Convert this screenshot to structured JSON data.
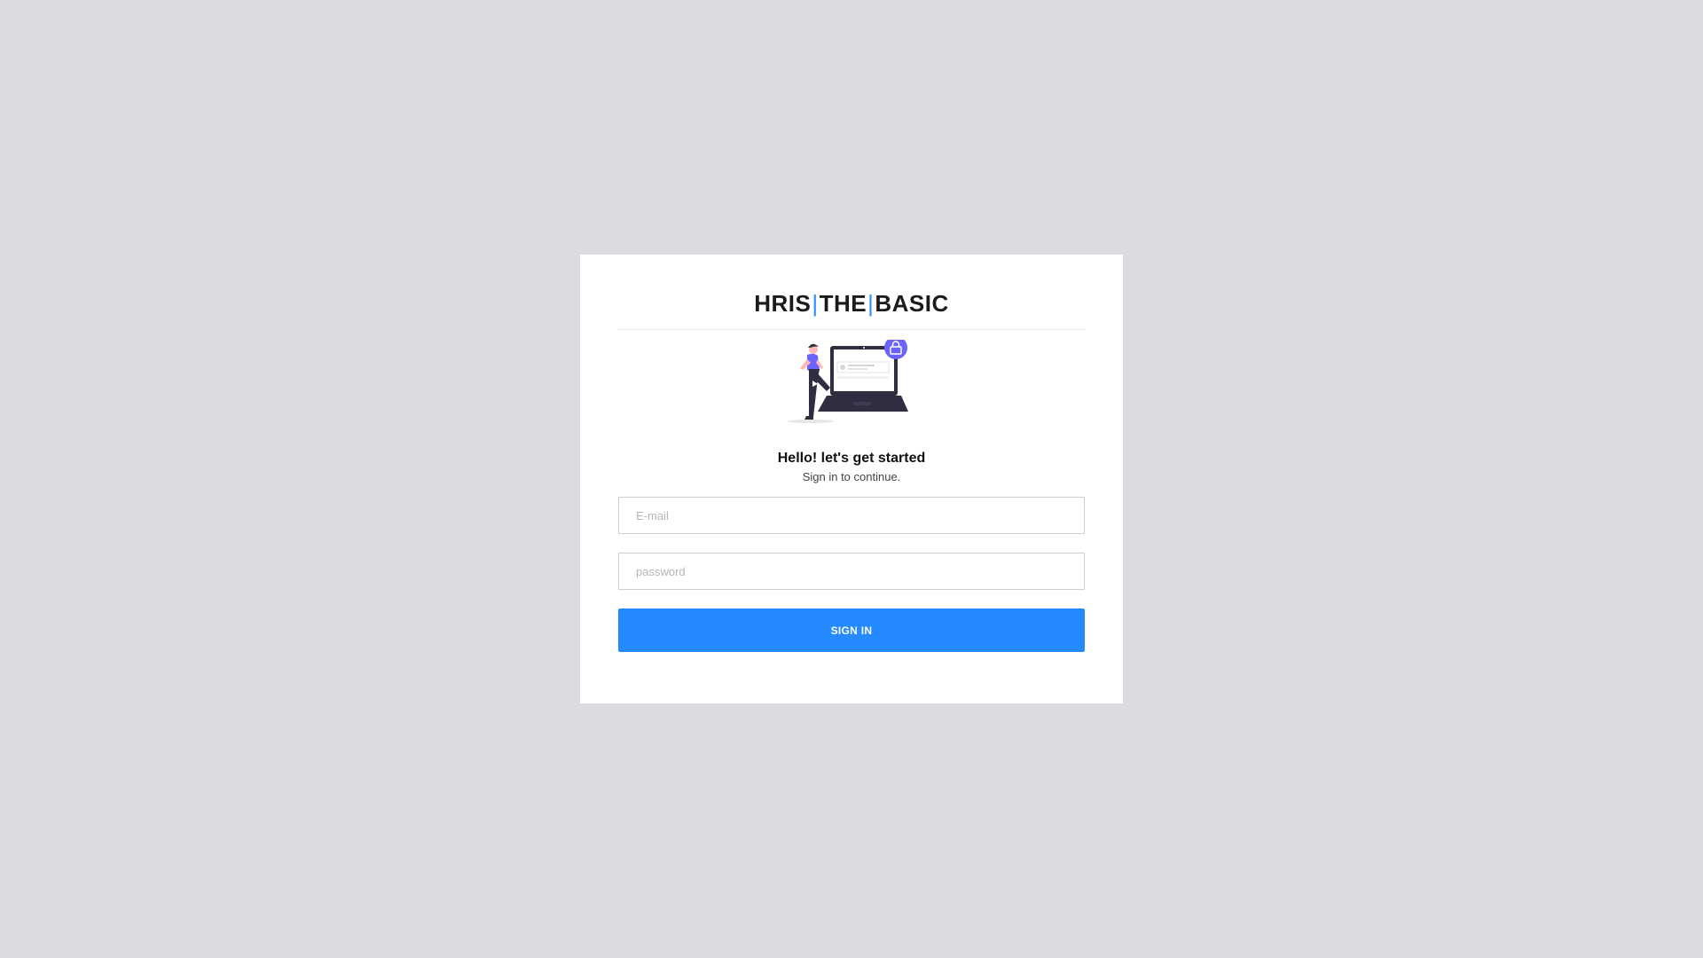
{
  "brand": {
    "part1": "HRIS",
    "separator": "|",
    "part2": "THE",
    "part3": "BASIC"
  },
  "login": {
    "greeting": "Hello! let's get started",
    "subtitle": "Sign in to continue.",
    "email_placeholder": "E-mail",
    "password_placeholder": "password",
    "signin_label": "SIGN IN"
  },
  "illustration": {
    "icon": "lock-icon"
  },
  "colors": {
    "background": "#dcdce0",
    "card": "#ffffff",
    "accent": "#2589ff",
    "illustration_purple": "#6c63ff",
    "illustration_dark": "#2f2e41"
  }
}
